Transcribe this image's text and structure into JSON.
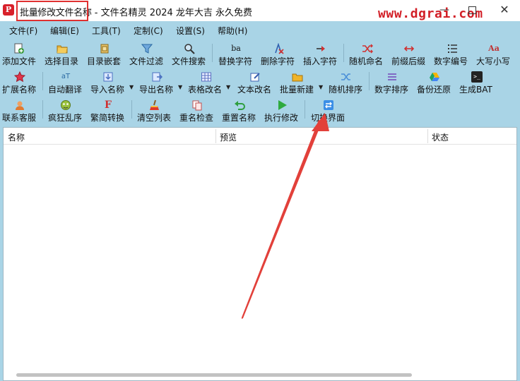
{
  "window": {
    "title_primary": "批量修改文件名称",
    "title_rest": " -  文件名精灵 2024 龙年大吉 永久免费",
    "app_icon_glyph": "P",
    "watermark": "www.dgrai.com",
    "min_glyph": "—",
    "close_glyph": "✕"
  },
  "menu": [
    "文件(F)",
    "编辑(E)",
    "工具(T)",
    "定制(C)",
    "设置(S)",
    "帮助(H)"
  ],
  "toolbar": {
    "row1": [
      "添加文件",
      "选择目录",
      "目录嵌套",
      "文件过滤",
      "文件搜索",
      "替换字符",
      "删除字符",
      "插入字符",
      "随机命名",
      "前缀后缀",
      "数字编号",
      "大写小写"
    ],
    "row2": [
      "扩展名称",
      "自动翻译",
      "导入名称",
      "导出名称",
      "表格改名",
      "文本改名",
      "批量新建",
      "随机排序",
      "数字排序",
      "备份还原",
      "生成BAT"
    ],
    "row3": [
      "联系客服",
      "疯狂乱序",
      "繁简转换",
      "清空列表",
      "重名检查",
      "重置名称",
      "执行修改",
      "切换界面"
    ],
    "icon_glyphs": {
      "add": "+",
      "replace": "ba",
      "case": "Aa",
      "translate": "aT",
      "tradsimp": "F",
      "bat": ">_"
    }
  },
  "list": {
    "columns": [
      "名称",
      "预览",
      "状态"
    ]
  },
  "colors": {
    "background": "#a9d4e6",
    "highlight_red": "#e03030",
    "watermark_red": "#d21f27",
    "arrow_red": "#e2403a"
  }
}
